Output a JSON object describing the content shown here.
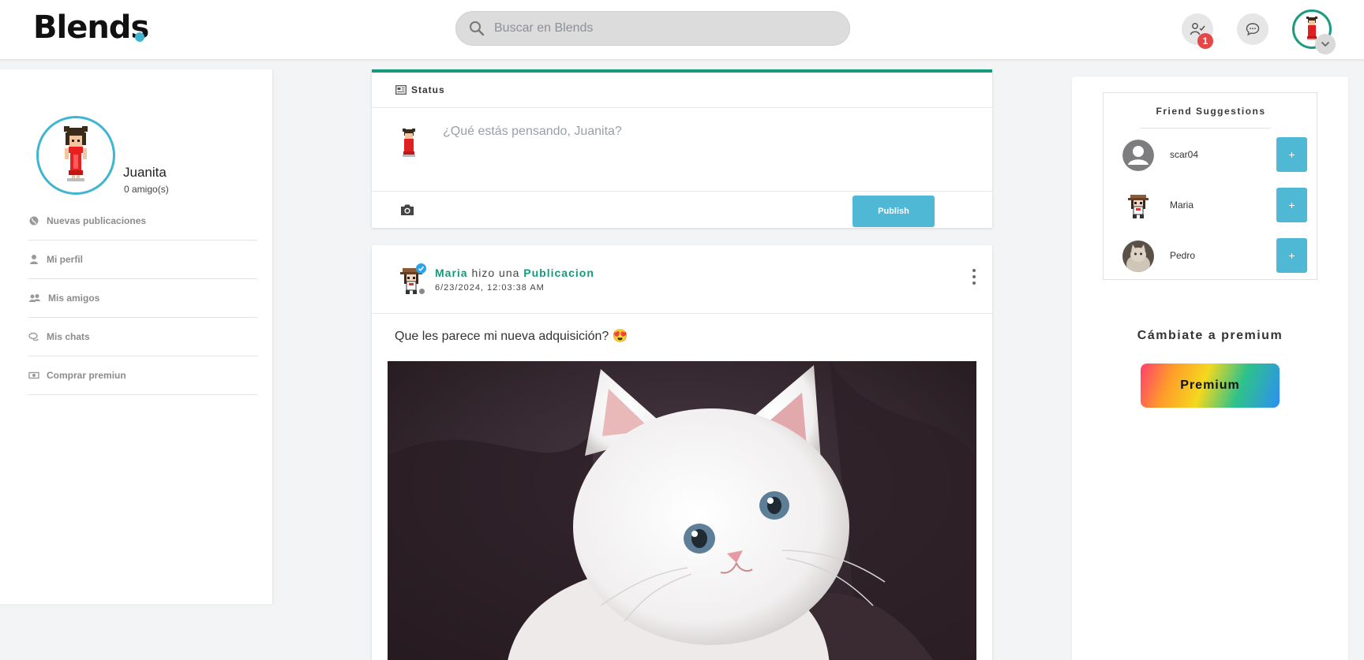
{
  "header": {
    "logo": "Blends",
    "search_placeholder": "Buscar en Blends",
    "notification_count": "1"
  },
  "profile": {
    "name": "Juanita",
    "friends": "0 amigo(s)"
  },
  "menu": [
    {
      "label": "Nuevas publicaciones",
      "icon": "globe-icon"
    },
    {
      "label": "Mi perfil",
      "icon": "user-icon"
    },
    {
      "label": "Mis amigos",
      "icon": "users-icon"
    },
    {
      "label": "Mis chats",
      "icon": "chat-icon"
    },
    {
      "label": "Comprar premiun",
      "icon": "money-icon"
    }
  ],
  "status": {
    "title": "Status",
    "placeholder": "¿Qué estás pensando, Juanita?",
    "publish_label": "Publish"
  },
  "post": {
    "author": "Maria",
    "action": "hizo una",
    "type": "Publicacion",
    "date": "6/23/2024, 12:03:38 AM",
    "text": "Que les parece mi nueva adquisición? 😍",
    "image": "white-kitten-photo"
  },
  "suggestions": {
    "title": "Friend Suggestions",
    "items": [
      {
        "name": "scar04",
        "avatar": "default-user-avatar",
        "add_label": "+"
      },
      {
        "name": "Maria",
        "avatar": "pixel-girl-hat-avatar",
        "add_label": "+"
      },
      {
        "name": "Pedro",
        "avatar": "cat-photo-avatar",
        "add_label": "+"
      }
    ]
  },
  "premium": {
    "title": "Cámbiate a premium",
    "button_label": "Premium"
  },
  "colors": {
    "accent_green": "#16987d",
    "accent_blue": "#4fb8d5",
    "logo_dot": "#3fb6d0",
    "badge_red": "#e54646"
  }
}
